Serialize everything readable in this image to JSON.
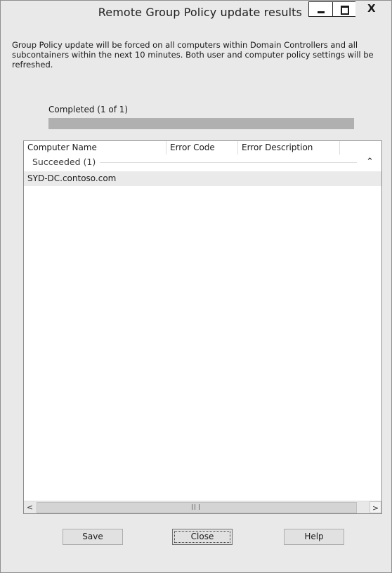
{
  "window": {
    "title": "Remote Group Policy update results",
    "minimize_glyph": "minimize-icon",
    "maximize_glyph": "maximize-icon",
    "close_glyph": "X"
  },
  "description": "Group Policy update will be forced on all computers within Domain Controllers and all subcontainers within the next 10 minutes. Both user and computer policy settings will be refreshed.",
  "progress": {
    "label": "Completed (1 of 1)",
    "completed": 1,
    "total": 1,
    "fraction": 1.0
  },
  "results": {
    "columns": [
      "Computer Name",
      "Error Code",
      "Error Description"
    ],
    "group": {
      "label": "Succeeded (1)",
      "collapse_icon": "chevron-up-icon"
    },
    "rows": [
      {
        "computer_name": "SYD-DC.contoso.com",
        "error_code": "",
        "error_description": ""
      }
    ],
    "scroll_left": "<",
    "scroll_right": ">"
  },
  "buttons": {
    "save": "Save",
    "close": "Close",
    "help": "Help"
  }
}
